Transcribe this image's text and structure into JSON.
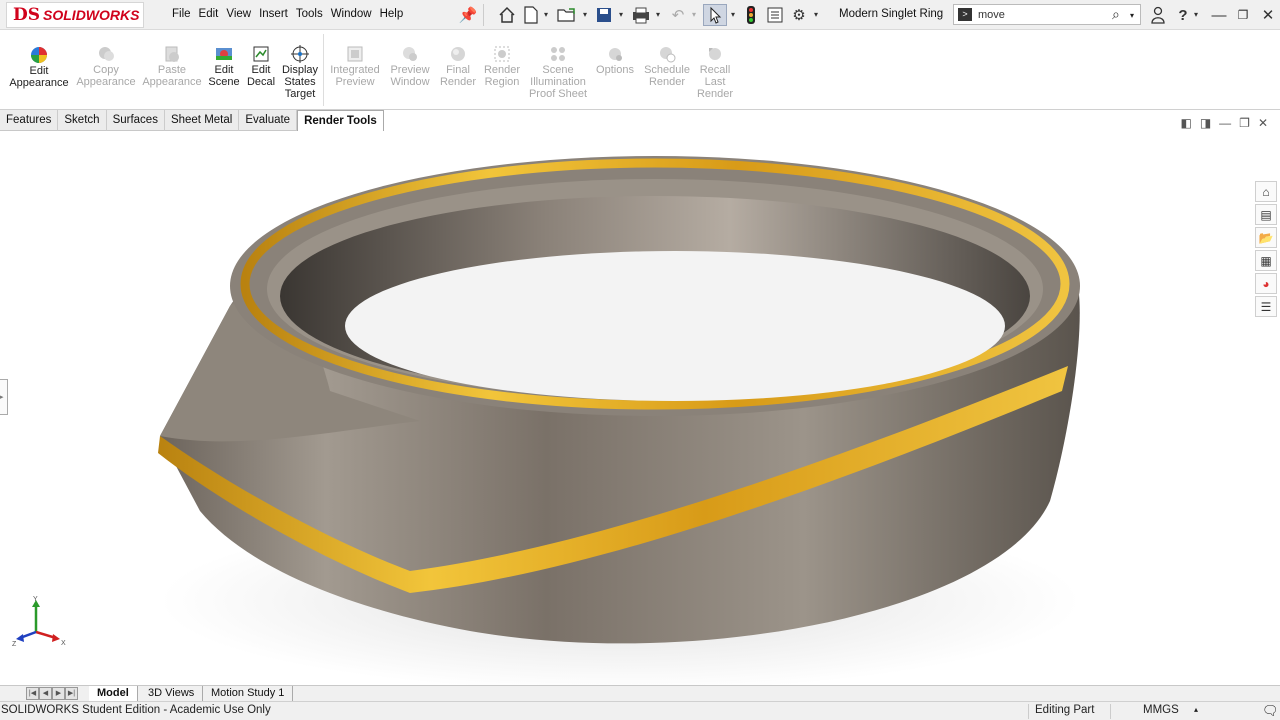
{
  "app": {
    "logo_ds": "DS",
    "logo_text": "SOLIDWORKS"
  },
  "menu": [
    "File",
    "Edit",
    "View",
    "Insert",
    "Tools",
    "Window",
    "Help"
  ],
  "document_title": "Modern Singlet Ring",
  "search": {
    "value": "move"
  },
  "ribbon": {
    "buttons": [
      {
        "label": "Edit Appearance",
        "enabled": true
      },
      {
        "label": "Copy Appearance",
        "enabled": false
      },
      {
        "label": "Paste Appearance",
        "enabled": false
      },
      {
        "label": "Edit Scene",
        "enabled": true
      },
      {
        "label": "Edit Decal",
        "enabled": true
      },
      {
        "label": "Display States Target",
        "enabled": true
      },
      {
        "label": "Integrated Preview",
        "enabled": false
      },
      {
        "label": "Preview Window",
        "enabled": false
      },
      {
        "label": "Final Render",
        "enabled": false
      },
      {
        "label": "Render Region",
        "enabled": false
      },
      {
        "label": "Scene Illumination Proof Sheet",
        "enabled": false
      },
      {
        "label": "Options",
        "enabled": false
      },
      {
        "label": "Schedule Render",
        "enabled": false
      },
      {
        "label": "Recall Last Render",
        "enabled": false
      }
    ]
  },
  "command_tabs": [
    "Features",
    "Sketch",
    "Surfaces",
    "Sheet Metal",
    "Evaluate",
    "Render Tools"
  ],
  "active_command_tab": "Render Tools",
  "triad": {
    "x": "X",
    "y": "Y",
    "z": "Z"
  },
  "bottom_tabs": [
    "Model",
    "3D Views",
    "Motion Study 1"
  ],
  "active_bottom_tab": "Model",
  "status": {
    "text": "SOLIDWORKS Student Edition - Academic Use Only",
    "mode": "Editing Part",
    "units": "MMGS"
  },
  "colors": {
    "brand": "#d0021b",
    "gold": "#e0a814",
    "metal": "#8c8378"
  }
}
